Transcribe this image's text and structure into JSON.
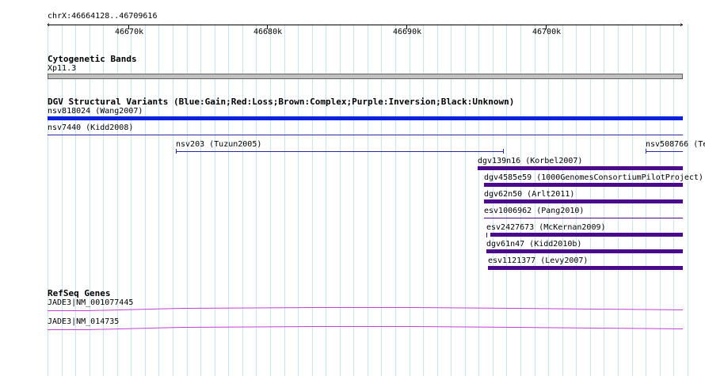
{
  "ruler": {
    "title": "chrX:46664128..46709616",
    "ticks": [
      "46670k",
      "46680k",
      "46690k",
      "46700k"
    ]
  },
  "tracks": {
    "cytoband": {
      "title": "Cytogenetic Bands",
      "band_label": "Xp11.3"
    },
    "dgv": {
      "title": "DGV Structural Variants (Blue:Gain;Red:Loss;Brown:Complex;Purple:Inversion;Black:Unknown)",
      "features": [
        {
          "label": "nsv818024 (Wang2007)",
          "color": "#0a22dd"
        },
        {
          "label": "nsv7440 (Kidd2008)",
          "color": "#2a2aa0"
        },
        {
          "label": "nsv203 (Tuzun2005)",
          "color": "#2a2aa0"
        },
        {
          "label": "nsv508766 (Te",
          "color": "#2a2aa0"
        },
        {
          "label": "dgv139n16 (Korbel2007)",
          "color": "#4b0a8c"
        },
        {
          "label": "dgv4585e59 (1000GenomesConsortiumPilotProject)",
          "color": "#4b0a8c"
        },
        {
          "label": "dgv62n50 (Arlt2011)",
          "color": "#4b0a8c"
        },
        {
          "label": "esv1006962 (Pang2010)",
          "color": "#4b0a8c"
        },
        {
          "label": "esv2427673 (McKernan2009)",
          "color": "#4b0a8c"
        },
        {
          "label": "dgv61n47 (Kidd2010b)",
          "color": "#4b0a8c"
        },
        {
          "label": "esv1121377 (Levy2007)",
          "color": "#4b0a8c"
        }
      ]
    },
    "refseq": {
      "title": "RefSeq Genes",
      "color": "#c040d0",
      "genes": [
        {
          "label": "JADE3|NM_001077445"
        },
        {
          "label": "JADE3|NM_014735"
        }
      ]
    }
  }
}
